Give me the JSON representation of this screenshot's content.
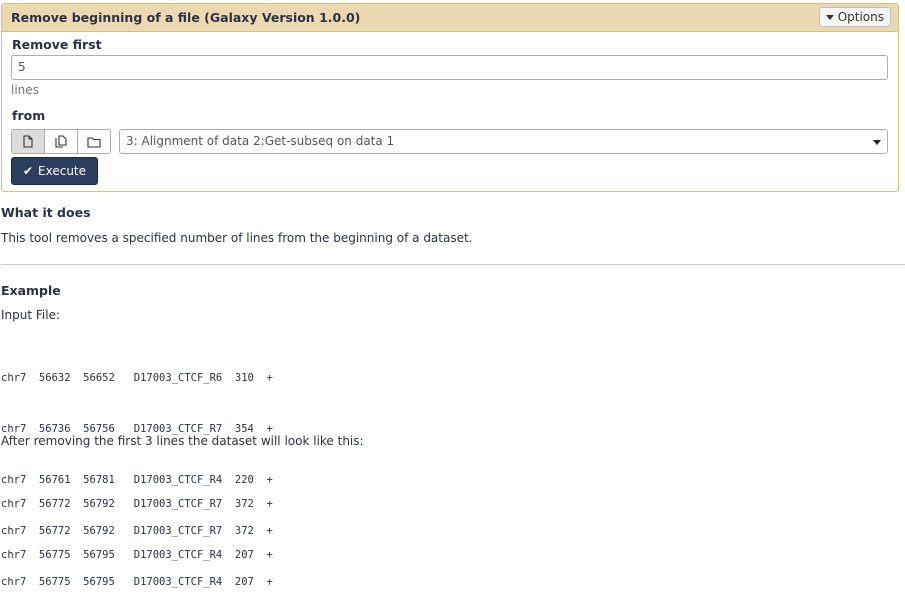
{
  "tool": {
    "title": "Remove beginning of a file (Galaxy Version 1.0.0)",
    "options_label": "Options"
  },
  "form": {
    "remove_first_label": "Remove first",
    "remove_first_value": "5",
    "remove_first_help": "lines",
    "from_label": "from",
    "source_buttons": [
      "single-dataset-icon",
      "multiple-datasets-icon",
      "dataset-collection-icon"
    ],
    "from_value": "3: Alignment of data 2:Get-subseq on data 1",
    "execute_label": "Execute"
  },
  "help": {
    "what_it_does_heading": "What it does",
    "description": "This tool removes a specified number of lines from the beginning of a dataset.",
    "example_heading": "Example",
    "input_file_label": "Input File:",
    "input_lines": [
      "chr7  56632  56652   D17003_CTCF_R6  310  +",
      "chr7  56736  56756   D17003_CTCF_R7  354  +",
      "chr7  56761  56781   D17003_CTCF_R4  220  +",
      "chr7  56772  56792   D17003_CTCF_R7  372  +",
      "chr7  56775  56795   D17003_CTCF_R4  207  +"
    ],
    "after_label": "After removing the first 3 lines the dataset will look like this:",
    "output_lines": [
      "chr7  56772  56792   D17003_CTCF_R7  372  +",
      "chr7  56775  56795   D17003_CTCF_R4  207  +"
    ]
  }
}
